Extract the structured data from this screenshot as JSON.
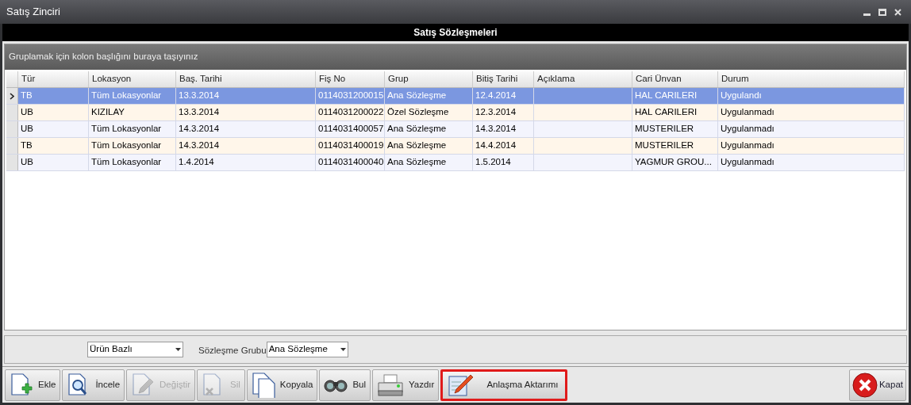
{
  "window": {
    "title": "Satış Zinciri"
  },
  "header": {
    "title": "Satış Sözleşmeleri"
  },
  "group_panel": {
    "hint": "Gruplamak için kolon başlığını buraya taşıyınız"
  },
  "table": {
    "columns": [
      "Tür",
      "Lokasyon",
      "Baş. Tarihi",
      "Fiş No",
      "Grup",
      "Bitiş Tarihi",
      "Açıklama",
      "Cari Ünvan",
      "Durum"
    ],
    "rows": [
      {
        "selected": true,
        "cells": [
          "TB",
          "Tüm Lokasyonlar",
          "13.3.2014",
          "0114031200015",
          "Ana Sözleşme",
          "12.4.2014",
          "",
          "HAL CARILERI",
          "Uygulandı"
        ]
      },
      {
        "selected": false,
        "cells": [
          "UB",
          "KIZILAY",
          "13.3.2014",
          "0114031200022",
          "Özel Sözleşme",
          "12.3.2014",
          "",
          "HAL CARILERI",
          "Uygulanmadı"
        ]
      },
      {
        "selected": false,
        "cells": [
          "UB",
          "Tüm Lokasyonlar",
          "14.3.2014",
          "0114031400057",
          "Ana Sözleşme",
          "14.3.2014",
          "",
          "MUSTERILER",
          "Uygulanmadı"
        ]
      },
      {
        "selected": false,
        "cells": [
          "TB",
          "Tüm Lokasyonlar",
          "14.3.2014",
          "0114031400019",
          "Ana Sözleşme",
          "14.4.2014",
          "",
          "MUSTERILER",
          "Uygulanmadı"
        ]
      },
      {
        "selected": false,
        "cells": [
          "UB",
          "Tüm Lokasyonlar",
          "1.4.2014",
          "0114031400040",
          "Ana Sözleşme",
          "1.5.2014",
          "",
          "YAGMUR GROU...",
          "Uygulanmadı"
        ]
      }
    ]
  },
  "filters": {
    "type_select": {
      "value": "Ürün Bazlı"
    },
    "group_label": "Sözleşme Grubu",
    "group_select": {
      "value": "Ana Sözleşme"
    }
  },
  "toolbar": [
    {
      "label": "Ekle",
      "kind": "add",
      "disabled": false,
      "highlighted": false
    },
    {
      "label": "İncele",
      "kind": "inspect",
      "disabled": false,
      "highlighted": false
    },
    {
      "label": "Değiştir",
      "kind": "edit",
      "disabled": true,
      "highlighted": false
    },
    {
      "label": "Sil",
      "kind": "delete",
      "disabled": true,
      "highlighted": false
    },
    {
      "label": "Kopyala",
      "kind": "copy",
      "disabled": false,
      "highlighted": false
    },
    {
      "label": "Bul",
      "kind": "find",
      "disabled": false,
      "highlighted": false
    },
    {
      "label": "Yazdır",
      "kind": "print",
      "disabled": false,
      "highlighted": false
    },
    {
      "label": "Anlaşma Aktarımı",
      "kind": "transfer",
      "disabled": false,
      "highlighted": true
    }
  ],
  "close_button": {
    "label": "Kapat"
  }
}
